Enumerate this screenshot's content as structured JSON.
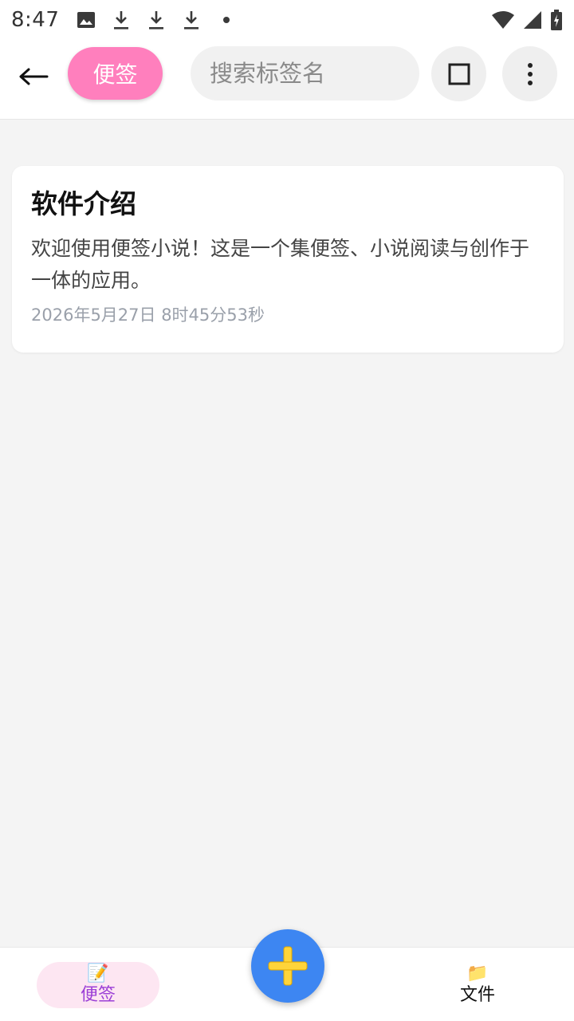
{
  "status_bar": {
    "time": "8:47",
    "left_icons": [
      "image-icon",
      "download-icon",
      "download-icon",
      "download-icon",
      "dot-icon"
    ],
    "right_icons": [
      "wifi-icon",
      "signal-icon",
      "battery-icon"
    ]
  },
  "app_bar": {
    "back_icon": "back-arrow-icon",
    "category_label": "便签",
    "category_color": "#ff7fbd",
    "search_placeholder": "搜索标签名",
    "select_icon": "square-icon",
    "more_icon": "more-vertical-icon"
  },
  "notes": [
    {
      "title": "软件介绍",
      "body": "欢迎使用便签小说！这是一个集便签、小说阅读与创作于一体的应用。",
      "time": "2026年5月27日 8时45分53秒"
    }
  ],
  "bottom_nav": {
    "items": [
      {
        "label": "便签",
        "icon": "📝",
        "active": true
      },
      {
        "label": "文件",
        "icon": "📁",
        "active": false
      }
    ],
    "fab_icon": "plus-icon",
    "fab_color": "#3d86f2",
    "active_color": "#9b3fd6"
  }
}
